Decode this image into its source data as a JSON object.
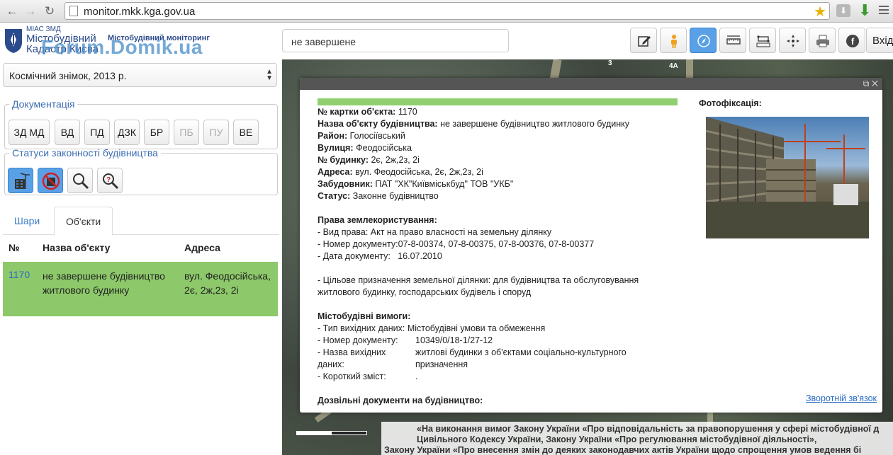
{
  "browser": {
    "url": "monitor.mkk.kga.gov.ua"
  },
  "header": {
    "logo_line1": "МІАС ЗМД",
    "logo_line2": "Містобудівний",
    "logo_line3": "Кадастр Києва",
    "subtitle": "Містобудівний моніторинг",
    "watermark": "Forum.Domik.ua",
    "search_value": "не завершене",
    "login_label": "Вхід",
    "dot_colors": [
      "#5a9ad6",
      "#e6dc6a",
      "#d86a8a"
    ]
  },
  "left_panel": {
    "layer_select": "Космічний знімок, 2013 р.",
    "docs_legend": "Документація",
    "doc_buttons": [
      {
        "label": "ЗД МД",
        "enabled": true
      },
      {
        "label": "ВД",
        "enabled": true
      },
      {
        "label": "ПД",
        "enabled": true
      },
      {
        "label": "ДЗК",
        "enabled": true
      },
      {
        "label": "БР",
        "enabled": true
      },
      {
        "label": "ПБ",
        "enabled": false
      },
      {
        "label": "ПУ",
        "enabled": false
      },
      {
        "label": "ВЕ",
        "enabled": true
      }
    ],
    "status_legend": "Статуси законності будівництва",
    "tabs": [
      "Шари",
      "Об'єкти"
    ],
    "table_headers": [
      "№",
      "Назва об'єкту",
      "Адреса"
    ],
    "rows": [
      {
        "id": "1170",
        "name": "не завершене будівництво житлового будинку",
        "address": "вул. Феодосійська, 2є, 2ж,2з, 2і"
      }
    ]
  },
  "map": {
    "labels": [
      "3",
      "4А"
    ],
    "ticker": [
      "«На виконання вимог Закону України «Про відповідальність за правопорушення у сфері містобудівної д",
      "Цивільного Кодексу України, Закону України «Про регулювання містобудівної діяльності»,",
      "Закону України «Про внесення змін до деяких законодавчих актів України щодо спрощення умов ведення бі"
    ]
  },
  "popup": {
    "card_label": "№ картки об'єкта:",
    "card_value": "1170",
    "name_label": "Назва об'єкту будівництва:",
    "name_value": "не завершене будівництво житлового будинку",
    "district_label": "Район:",
    "district_value": "Голосіївський",
    "street_label": "Вулиця:",
    "street_value": "Феодосійська",
    "building_label": "№ будинку:",
    "building_value": "2є, 2ж,2з, 2і",
    "address_label": "Адреса:",
    "address_value": "вул. Феодосійська, 2є, 2ж,2з, 2і",
    "developer_label": "Забудовник:",
    "developer_value": "ПАТ \"ХК\"Київміськбуд\" ТОВ \"УКБ\"",
    "status_label": "Статус:",
    "status_value": "Законне будівництво",
    "land_title": "Права землекористування:",
    "land_kind": "- Вид права: Акт на право власності на земельну ділянку",
    "land_docnum": "- Номер документу:07-8-00374, 07-8-00375, 07-8-00376, 07-8-00377",
    "land_date": "- Дата документу:   16.07.2010",
    "land_purpose_1": "- Цільове призначення земельної ділянки: для будівництва та обслуговування",
    "land_purpose_2": "житлового будинку, господарських будівель і споруд",
    "req_title": "Містобудівні вимоги:",
    "req_type": "- Тип вихідних даних: Містобудівні умови та обмеження",
    "req_docnum_k": "- Номер документу:",
    "req_docnum_v": "10349/0/18-1/27-12",
    "req_name_k1": "- Назва вихідних",
    "req_name_k2": "даних:",
    "req_name_v1": "житлові будинки з об'єктами соціально-культурного",
    "req_name_v2": "призначення",
    "req_summary_k": "- Короткий зміст:",
    "req_summary_v": ".",
    "permits_title": "Дозвільні документи на будівництво:",
    "photo_label": "Фотофіксація:",
    "feedback_link": "Зворотній зв'язок"
  }
}
